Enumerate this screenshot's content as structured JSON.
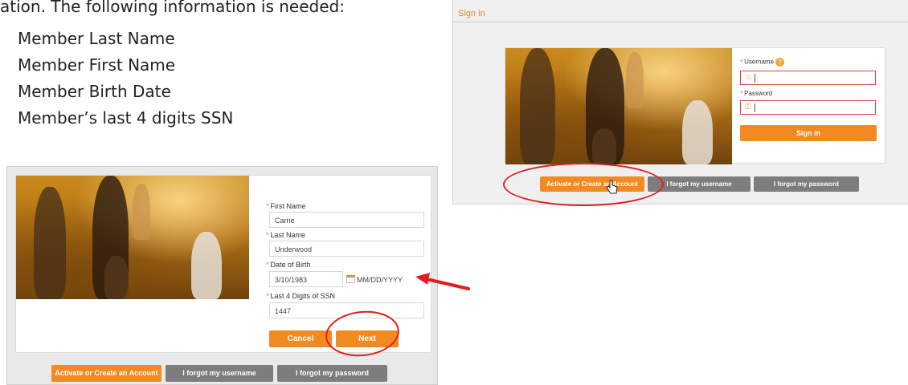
{
  "doc": {
    "intro": "ation.  The following information is needed:",
    "items": [
      "Member Last Name",
      "Member First Name",
      "Member Birth Date",
      "Member’s last 4 digits SSN"
    ]
  },
  "register_form": {
    "first_name": {
      "label": "First Name",
      "value": "Carrie"
    },
    "last_name": {
      "label": "Last Name",
      "value": "Underwood"
    },
    "dob": {
      "label": "Date of Birth",
      "value": "3/10/1983",
      "format_hint": "MM/DD/YYYY"
    },
    "ssn": {
      "label": "Last 4 Digits of SSN",
      "value": "1447"
    },
    "cancel_label": "Cancel",
    "next_label": "Next",
    "required_marker": "*"
  },
  "left_bottom_buttons": {
    "activate": "Activate or Create an Account",
    "forgot_username": "I forgot my username",
    "forgot_password": "I forgot my password"
  },
  "signin": {
    "title": "Sign in",
    "username_label": "Username",
    "password_label": "Password",
    "help_icon_text": "?",
    "sign_in_label": "Sign in",
    "activate": "Activate or Create an Account",
    "forgot_username": "I forgot my username",
    "forgot_password": "I forgot my password"
  },
  "colors": {
    "accent_orange": "#f18a22",
    "button_gray": "#7d7d7d",
    "annotation_red": "#e01e1e",
    "error_border": "#d8443a"
  }
}
